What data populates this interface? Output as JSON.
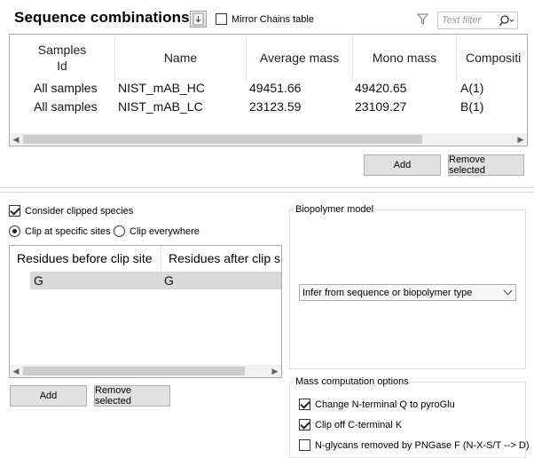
{
  "sequence_combinations": {
    "title": "Sequence combinations",
    "mirror_chains_label": "Mirror Chains table",
    "mirror_chains_checked": false,
    "filter_placeholder": "Text filter",
    "table": {
      "columns": [
        "Samples\nId",
        "Name",
        "Average mass",
        "Mono mass",
        "Compositi"
      ],
      "rows": [
        [
          "All samples",
          "NIST_mAB_HC",
          "49451.66",
          "49420.65",
          "A(1)"
        ],
        [
          "All samples",
          "NIST_mAB_LC",
          "23123.59",
          "23109.27",
          "B(1)"
        ]
      ]
    },
    "add_label": "Add",
    "remove_label": "Remove selected"
  },
  "clipping": {
    "consider_clipped_label": "Consider clipped species",
    "consider_clipped_checked": true,
    "clip_specific_label": "Clip at specific sites",
    "clip_everywhere_label": "Clip everywhere",
    "selected_mode": "Clip at specific sites",
    "table": {
      "columns": [
        "Residues before clip site",
        "Residues after clip si"
      ],
      "rows": [
        [
          "G",
          "G"
        ]
      ]
    },
    "add_label": "Add",
    "remove_label": "Remove selected"
  },
  "biopolymer_model": {
    "group_label": "Biopolymer model",
    "selected": "Infer from sequence or biopolymer type"
  },
  "mass_computation": {
    "group_label": "Mass computation options",
    "options": [
      {
        "label": "Change N-terminal Q to pyroGlu",
        "checked": true
      },
      {
        "label": "Clip off C-terminal K",
        "checked": true
      },
      {
        "label": "N-glycans removed by PNGase F (N-X-S/T --> D)",
        "checked": false
      }
    ]
  },
  "colors": {
    "selected_row": "#d9d9d9",
    "button_bg": "#e1e1e1",
    "border": "#a9a9a9"
  }
}
